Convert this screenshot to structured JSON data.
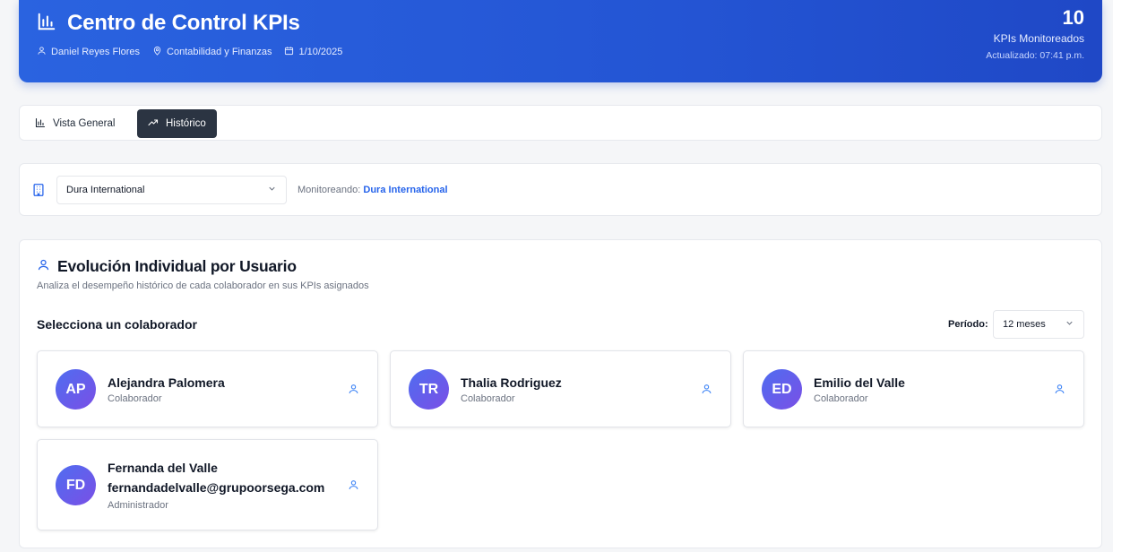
{
  "header": {
    "title": "Centro de Control KPIs",
    "user": "Daniel Reyes Flores",
    "department": "Contabilidad y Finanzas",
    "date": "1/10/2025",
    "kpi_count": "10",
    "kpi_count_label": "KPIs Monitoreados",
    "updated": "Actualizado: 07:41 p.m."
  },
  "tabs": [
    {
      "label": "Vista General"
    },
    {
      "label": "Histórico"
    }
  ],
  "company": {
    "selected": "Dura International",
    "monitoring_label": "Monitoreando:",
    "monitoring_value": "Dura International"
  },
  "evolution": {
    "title": "Evolución Individual por Usuario",
    "subtitle": "Analiza el desempeño histórico de cada colaborador en sus KPIs asignados",
    "select_label": "Selecciona un colaborador",
    "period_label": "Período:",
    "period_value": "12 meses",
    "users": [
      {
        "initials": "AP",
        "name": "Alejandra Palomera",
        "role": "Colaborador"
      },
      {
        "initials": "TR",
        "name": "Thalia Rodriguez",
        "role": "Colaborador"
      },
      {
        "initials": "ED",
        "name": "Emilio del Valle",
        "role": "Colaborador"
      },
      {
        "initials": "FD",
        "name": "Fernanda del Valle",
        "email": "fernandadelvalle@grupoorsega.com",
        "role": "Administrador"
      }
    ]
  },
  "colors": {
    "header_blue": "#2a63e0",
    "active_tab": "#2b3442",
    "accent_link": "#2563eb",
    "avatar_gradient_start": "#4f6df0",
    "avatar_gradient_end": "#7a4fe6"
  }
}
